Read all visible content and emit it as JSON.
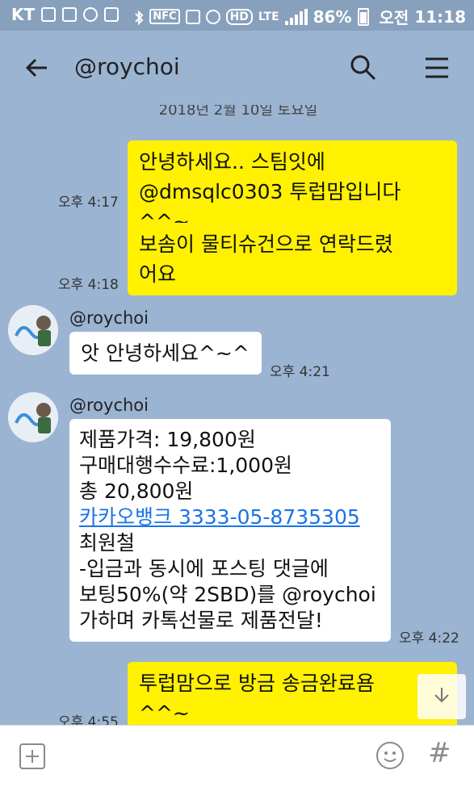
{
  "status_bar": {
    "carrier": "KT",
    "nfc": "NFC",
    "hd": "HD",
    "lte": "LTE",
    "battery": "86%",
    "ampm": "오전",
    "time": "11:18"
  },
  "header": {
    "title": "@roychoi",
    "back_icon": "arrow-left",
    "search_icon": "search",
    "menu_icon": "hamburger"
  },
  "date_separator": "2018년 2월 10일 토요일",
  "messages": [
    {
      "from": "me",
      "lines": [
        "안녕하세요.. 스팀잇에",
        "@dmsqlc0303 투럽맘입니다^^~"
      ],
      "time": "오후 4:17"
    },
    {
      "from": "me",
      "lines": [
        "보솜이 물티슈건으로 연락드렸",
        "어요"
      ],
      "time": "오후 4:18"
    },
    {
      "from": "them",
      "sender": "@roychoi",
      "lines": [
        "앗 안녕하세요^~^"
      ],
      "time": "오후 4:21"
    },
    {
      "from": "them",
      "sender": "@roychoi",
      "lines": [
        "제품가격: 19,800원",
        "구매대행수수료:1,000원",
        "총 20,800원",
        "카카오뱅크 3333-05-8735305",
        "최원철",
        "-입금과 동시에 포스팅 댓글에",
        "보팅50%(약 2SBD)를 @roychoi",
        "가하며 카톡선물로 제품전달!"
      ],
      "time": "오후 4:22"
    },
    {
      "from": "me",
      "lines": [
        "투럽맘으로 방금 송금완료욤",
        "^^~"
      ],
      "time": "오후 4:55"
    }
  ],
  "input_bar": {
    "plus_icon": "plus-square",
    "emoji_icon": "smiley",
    "hash_label": "#"
  },
  "colors": {
    "chat_bg": "#9bb4d2",
    "my_bubble": "#fff100",
    "their_bubble": "#ffffff",
    "link": "#1a73e8"
  }
}
